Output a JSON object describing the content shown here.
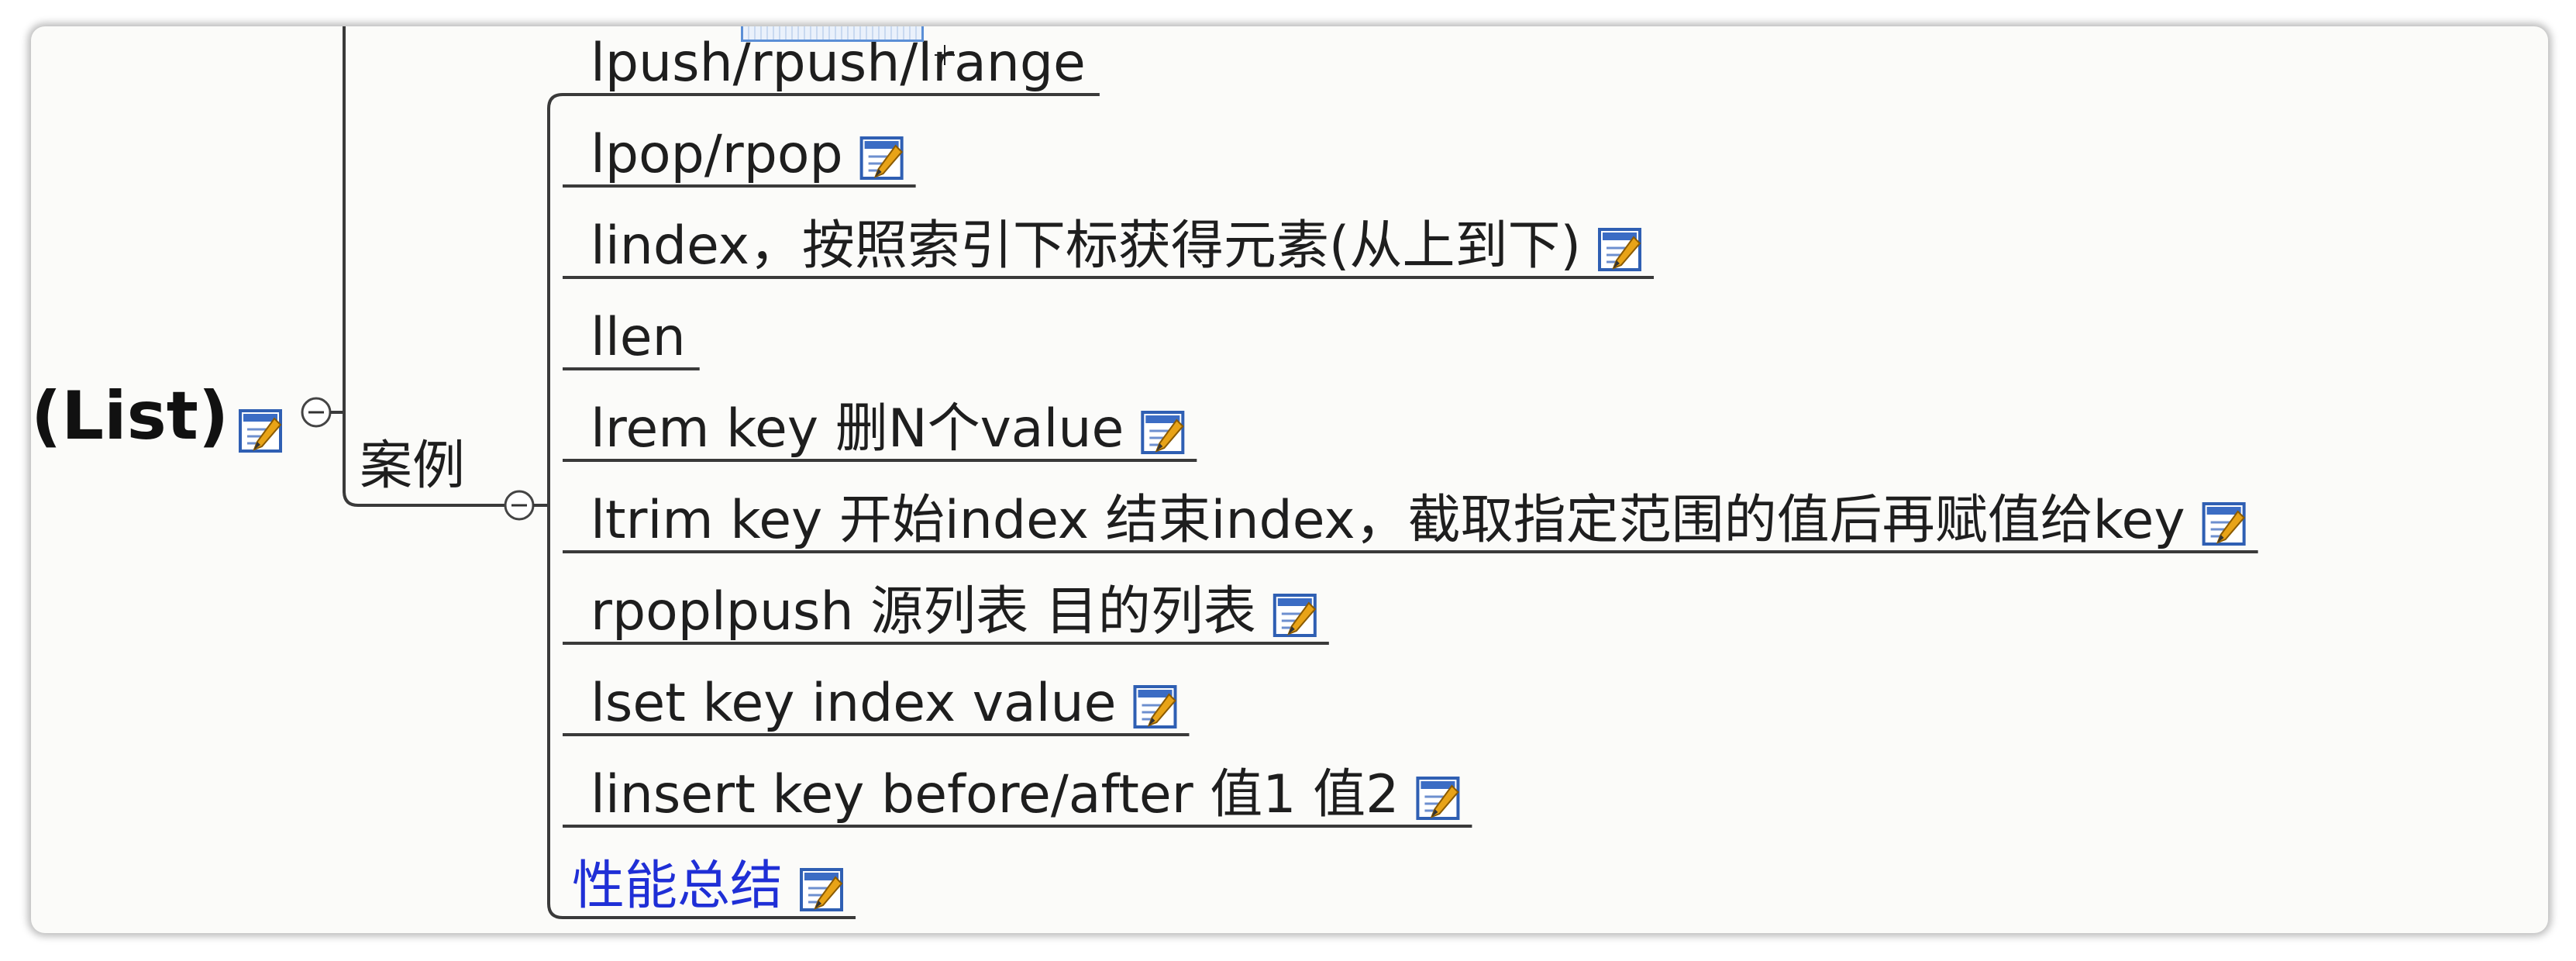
{
  "root": {
    "label": "(List)"
  },
  "branch": {
    "label": "案例"
  },
  "items": [
    {
      "label": "lpush/rpush/lrange",
      "has_note": false,
      "link": false
    },
    {
      "label": "lpop/rpop",
      "has_note": true,
      "link": false
    },
    {
      "label": "lindex，按照索引下标获得元素(从上到下)",
      "has_note": true,
      "link": false
    },
    {
      "label": "llen",
      "has_note": false,
      "link": false
    },
    {
      "label": "lrem key 删N个value",
      "has_note": true,
      "link": false
    },
    {
      "label": "ltrim key 开始index 结束index，截取指定范围的值后再赋值给key",
      "has_note": true,
      "link": false
    },
    {
      "label": "rpoplpush 源列表 目的列表",
      "has_note": true,
      "link": false
    },
    {
      "label": "lset key index value",
      "has_note": true,
      "link": false
    },
    {
      "label": "linsert key  before/after 值1 值2",
      "has_note": true,
      "link": false
    },
    {
      "label": "性能总结",
      "has_note": true,
      "link": true
    }
  ],
  "icons": {
    "note": "note-pencil-icon",
    "collapse": "collapse-minus-icon"
  },
  "colors": {
    "text": "#1e1e1e",
    "link_text": "#1f2fd6",
    "line": "#3a3a3a",
    "note_icon_blue": "#3b6cc4",
    "note_icon_pencil": "#e8a317",
    "background": "#fbfbf9"
  }
}
